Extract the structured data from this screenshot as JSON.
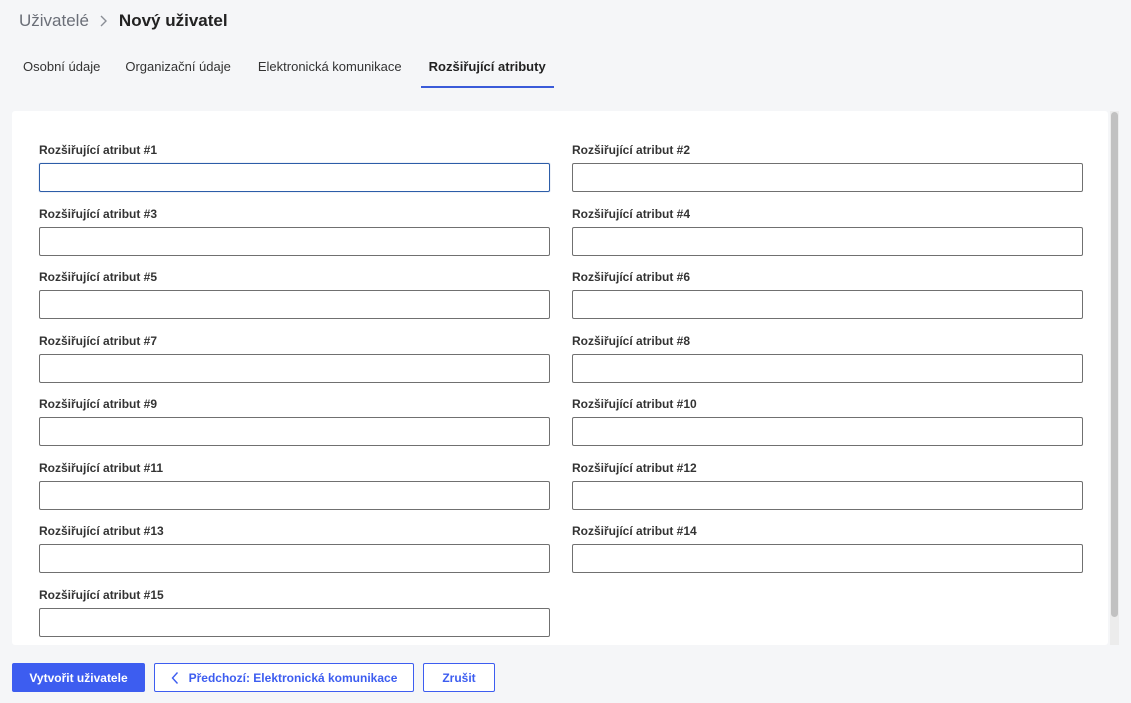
{
  "breadcrumb": {
    "parent": "Uživatelé",
    "current": "Nový uživatel",
    "separator_icon": "chevron-right-icon"
  },
  "tabs": [
    {
      "label": "Osobní údaje",
      "active": false
    },
    {
      "label": "Organizační údaje",
      "active": false
    },
    {
      "label": "Elektronická komunikace",
      "active": false
    },
    {
      "label": "Rozšiřující atributy",
      "active": true
    }
  ],
  "form": {
    "fields": [
      {
        "label": "Rozšiřující atribut #1",
        "value": "",
        "focused": true
      },
      {
        "label": "Rozšiřující atribut #2",
        "value": ""
      },
      {
        "label": "Rozšiřující atribut #3",
        "value": ""
      },
      {
        "label": "Rozšiřující atribut #4",
        "value": ""
      },
      {
        "label": "Rozšiřující atribut #5",
        "value": ""
      },
      {
        "label": "Rozšiřující atribut #6",
        "value": ""
      },
      {
        "label": "Rozšiřující atribut #7",
        "value": ""
      },
      {
        "label": "Rozšiřující atribut #8",
        "value": ""
      },
      {
        "label": "Rozšiřující atribut #9",
        "value": ""
      },
      {
        "label": "Rozšiřující atribut #10",
        "value": ""
      },
      {
        "label": "Rozšiřující atribut #11",
        "value": ""
      },
      {
        "label": "Rozšiřující atribut #12",
        "value": ""
      },
      {
        "label": "Rozšiřující atribut #13",
        "value": ""
      },
      {
        "label": "Rozšiřující atribut #14",
        "value": ""
      },
      {
        "label": "Rozšiřující atribut #15",
        "value": ""
      }
    ]
  },
  "footer": {
    "create_label": "Vytvořit uživatele",
    "prev_label": "Předchozí: Elektronická komunikace",
    "prev_icon": "chevron-left-icon",
    "cancel_label": "Zrušit"
  },
  "colors": {
    "accent": "#3d5df0",
    "tab_underline": "#3a5bd9",
    "page_background": "#f5f6f8",
    "panel_background": "#ffffff"
  }
}
